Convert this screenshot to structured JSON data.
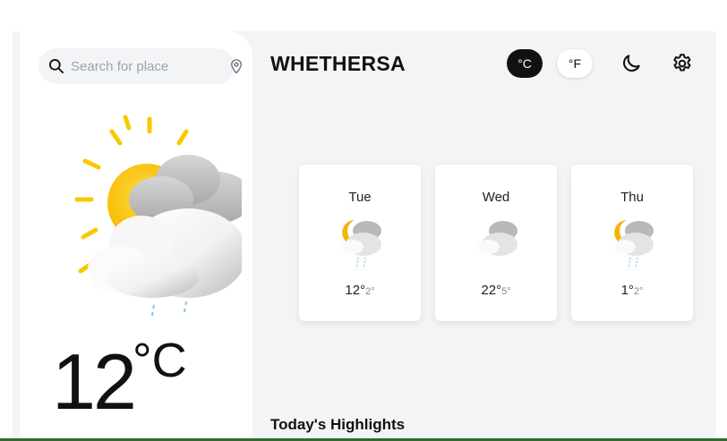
{
  "search": {
    "placeholder": "Search for place",
    "value": "",
    "icon": "search-icon",
    "location_icon": "location-pin-icon"
  },
  "current": {
    "icon": "partly-cloudy-rain-icon",
    "temperature": "12",
    "unit": "°C"
  },
  "header": {
    "brand": "WHETHERSA",
    "unit_celsius": "°C",
    "unit_fahrenheit": "°F",
    "selected_unit": "°C",
    "theme_icon": "moon-icon",
    "settings_icon": "gear-icon"
  },
  "forecast": [
    {
      "day": "Tue",
      "icon": "night-cloud-rain-icon",
      "max": "12°",
      "min": "2°"
    },
    {
      "day": "Wed",
      "icon": "cloudy-icon",
      "max": "22°",
      "min": "5°"
    },
    {
      "day": "Thu",
      "icon": "night-cloud-rain-icon",
      "max": "1°",
      "min": "2°"
    }
  ],
  "highlights": {
    "title": "Today's Highlights"
  },
  "colors": {
    "accent_dark": "#111111",
    "panel_bg": "#f3f4f6",
    "card_bg": "#ffffff",
    "sun": "#f8c200",
    "cloud": "#c9c9c9",
    "rain": "#7fc4e8"
  }
}
